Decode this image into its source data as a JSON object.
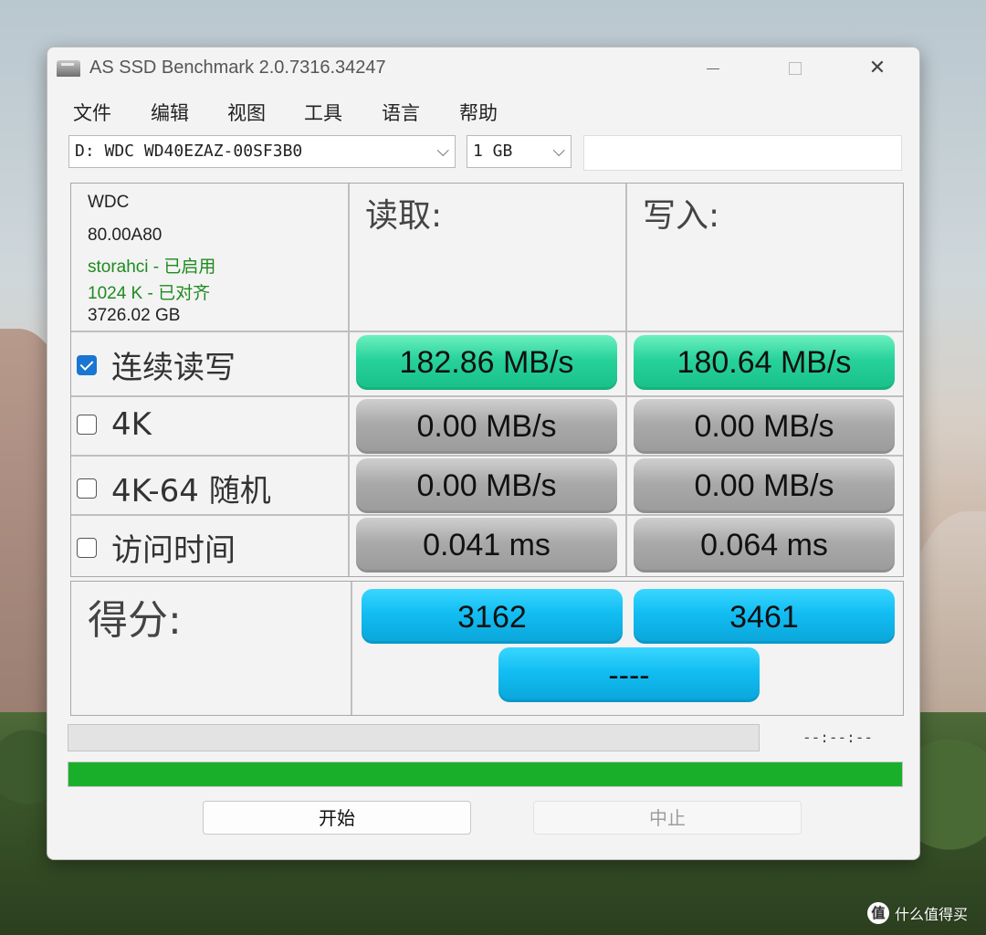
{
  "window": {
    "title": "AS SSD Benchmark 2.0.7316.34247",
    "controls": {
      "minimize": "",
      "maximize": "",
      "close": "✕"
    }
  },
  "menu": [
    "文件",
    "编辑",
    "视图",
    "工具",
    "语言",
    "帮助"
  ],
  "drive_select": {
    "value": "D: WDC WD40EZAZ-00SF3B0"
  },
  "size_select": {
    "value": "1 GB"
  },
  "drive_info": {
    "model": "WDC",
    "firmware": "80.00A80",
    "driver": "storahci - 已启用",
    "alignment": "1024 K - 已对齐",
    "capacity": "3726.02 GB"
  },
  "columns": {
    "read": "读取:",
    "write": "写入:"
  },
  "rows": [
    {
      "label": "连续读写",
      "checked": true,
      "read": "182.86 MB/s",
      "write": "180.64 MB/s"
    },
    {
      "label": "4K",
      "checked": false,
      "read": "0.00 MB/s",
      "write": "0.00 MB/s"
    },
    {
      "label": "4K-64 随机",
      "checked": false,
      "read": "0.00 MB/s",
      "write": "0.00 MB/s"
    },
    {
      "label": "访问时间",
      "checked": false,
      "read": "0.041 ms",
      "write": "0.064 ms"
    }
  ],
  "score": {
    "label": "得分:",
    "read": "3162",
    "write": "3461",
    "total": "----"
  },
  "progress": {
    "time": "--:--:--",
    "fill_percent": 100
  },
  "buttons": {
    "start": "开始",
    "stop": "中止"
  },
  "watermark": {
    "logo": "值",
    "text": "什么值得买"
  },
  "colors": {
    "accent_green": "#18c088",
    "score_blue": "#12bdf2",
    "progress_green": "#1aaf2b"
  }
}
